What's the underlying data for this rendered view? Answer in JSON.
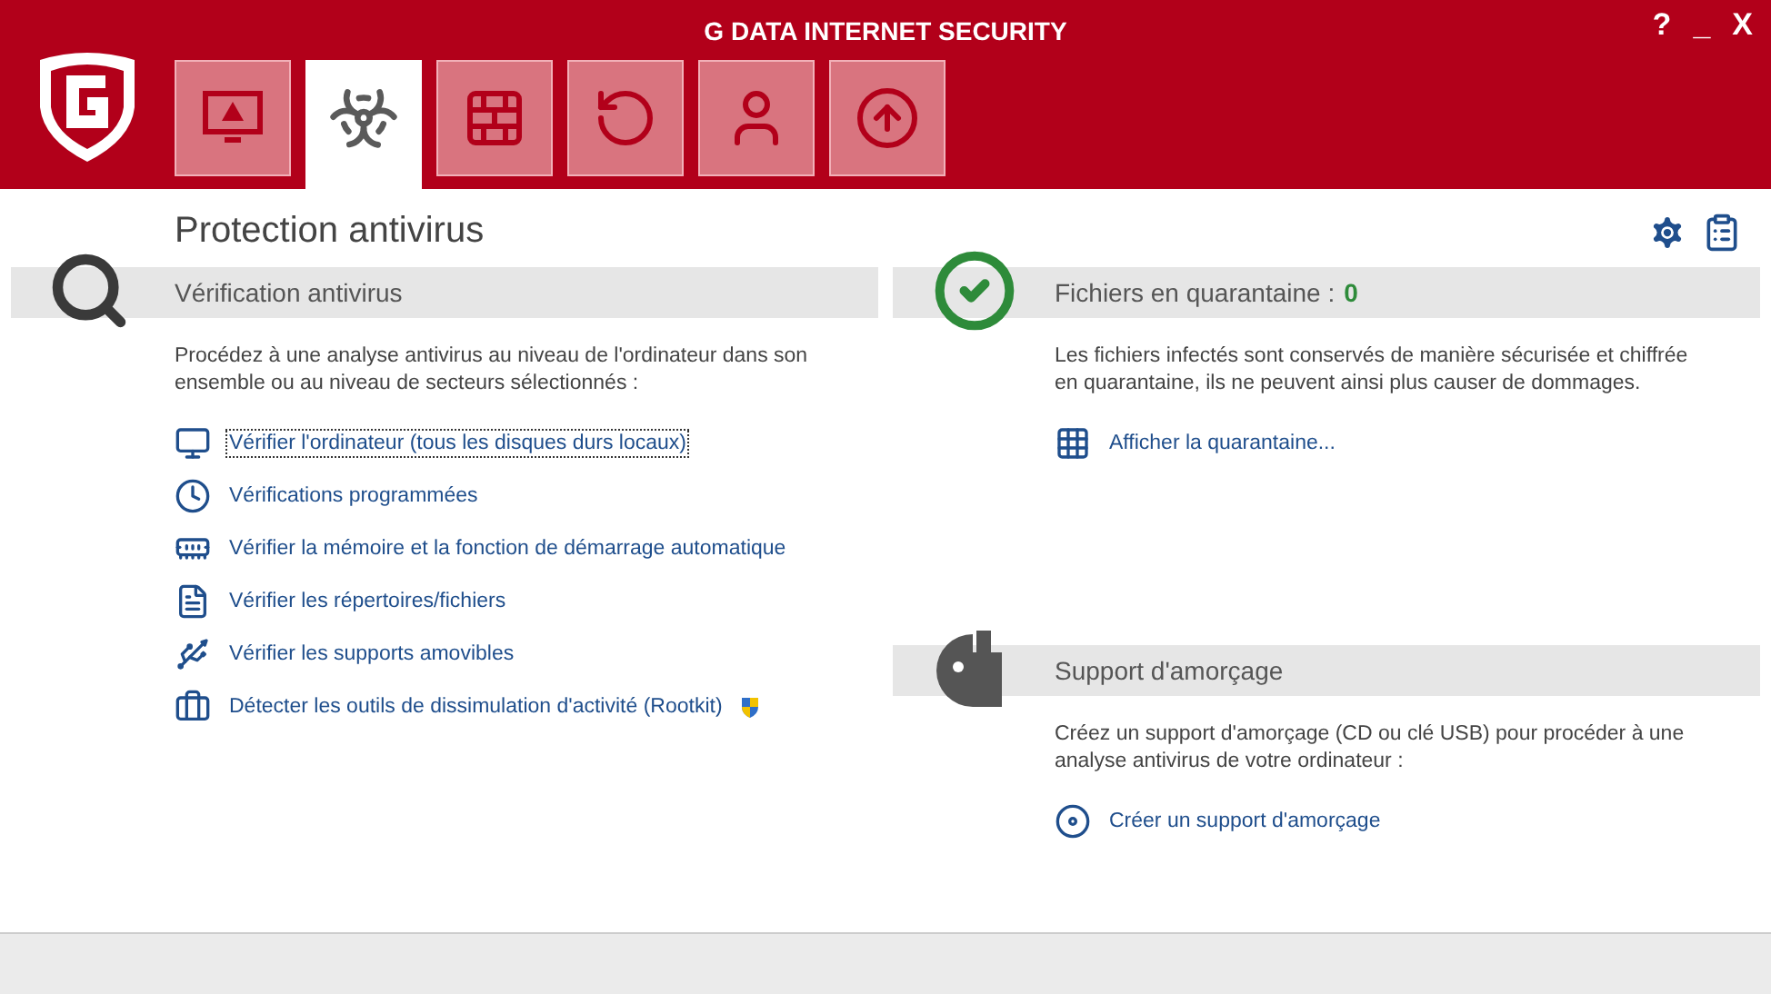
{
  "window": {
    "title": "G DATA INTERNET SECURITY",
    "controls": [
      "?",
      "_",
      "X"
    ]
  },
  "tabs": [
    {
      "selected": false
    },
    {
      "selected": true
    },
    {
      "selected": false
    },
    {
      "selected": false
    },
    {
      "selected": false
    },
    {
      "selected": false
    }
  ],
  "page_title": "Protection antivirus",
  "scan": {
    "heading": "Vérification antivirus",
    "description": "Procédez à une analyse antivirus au niveau de l'ordinateur dans son ensemble ou au niveau de secteurs sélectionnés :",
    "links": [
      {
        "label": "Vérifier l'ordinateur (tous les disques durs locaux)",
        "focused": true,
        "admin": false
      },
      {
        "label": "Vérifications programmées",
        "focused": false,
        "admin": false
      },
      {
        "label": "Vérifier la mémoire et la fonction de démarrage automatique",
        "focused": false,
        "admin": false
      },
      {
        "label": "Vérifier les répertoires/fichiers",
        "focused": false,
        "admin": false
      },
      {
        "label": "Vérifier les supports amovibles",
        "focused": false,
        "admin": false
      },
      {
        "label": "Détecter les outils de dissimulation d'activité (Rootkit)",
        "focused": false,
        "admin": true
      }
    ]
  },
  "quarantine": {
    "heading": "Fichiers en quarantaine :",
    "count": "0",
    "description": "Les fichiers infectés sont conservés de manière sécurisée et chiffrée en quarantaine, ils ne peuvent ainsi plus causer de dommages.",
    "link": "Afficher la quarantaine..."
  },
  "boot_media": {
    "heading": "Support d'amorçage",
    "description": "Créez un support d'amorçage (CD ou clé USB) pour procéder à une analyse antivirus de votre ordinateur :",
    "link": "Créer un support d'amorçage"
  }
}
